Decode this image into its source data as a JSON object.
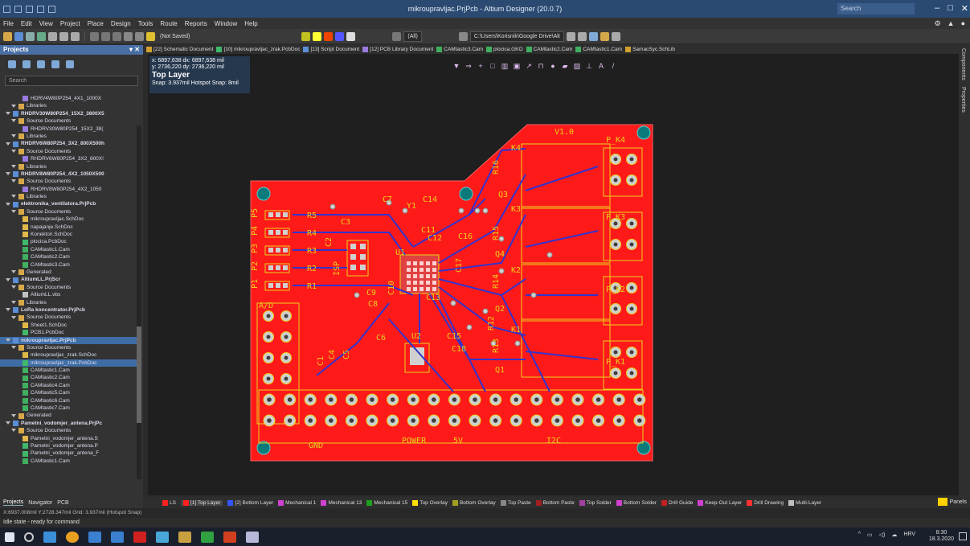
{
  "window": {
    "title": "mikroupravljac.PrjPcb - Altium Designer (20.0.7)",
    "search_placeholder": "Search"
  },
  "menu": [
    "File",
    "Edit",
    "View",
    "Project",
    "Place",
    "Design",
    "Tools",
    "Route",
    "Reports",
    "Window",
    "Help"
  ],
  "toolbar": {
    "saved_state": "(Not Saved)",
    "filter": "(All)",
    "path": "C:\\Users\\Korisnik\\Google Drive\\Alt"
  },
  "projects_panel": {
    "title": "Projects",
    "search_placeholder": "Search",
    "tree": [
      {
        "label": "HDRV4W80P254_4X1_1000X",
        "icon": "lib",
        "indent": 4
      },
      {
        "label": "Libraries",
        "icon": "folder",
        "indent": 2
      },
      {
        "label": "RHDRV30W80P254_15X2_3800X5",
        "icon": "proj",
        "indent": 1,
        "bold": true
      },
      {
        "label": "Source Documents",
        "icon": "folder",
        "indent": 2
      },
      {
        "label": "RHDRV30W80P254_15X2_38(",
        "icon": "lib",
        "indent": 4
      },
      {
        "label": "Libraries",
        "icon": "folder",
        "indent": 2
      },
      {
        "label": "RHDRV6W80P254_3X2_800X500h",
        "icon": "proj",
        "indent": 1,
        "bold": true
      },
      {
        "label": "Source Documents",
        "icon": "folder",
        "indent": 2
      },
      {
        "label": "RHDRV6W80P254_3X2_800X!",
        "icon": "lib",
        "indent": 4
      },
      {
        "label": "Libraries",
        "icon": "folder",
        "indent": 2
      },
      {
        "label": "RHDRV8W80P254_4X2_1050X500",
        "icon": "proj",
        "indent": 1,
        "bold": true
      },
      {
        "label": "Source Documents",
        "icon": "folder",
        "indent": 2
      },
      {
        "label": "RHDRV8W80P254_4X2_1050",
        "icon": "lib",
        "indent": 4
      },
      {
        "label": "Libraries",
        "icon": "folder",
        "indent": 2
      },
      {
        "label": "elektronika_ventilatora.PrjPcb",
        "icon": "proj",
        "indent": 1,
        "bold": true
      },
      {
        "label": "Source Documents",
        "icon": "folder",
        "indent": 2
      },
      {
        "label": "mikroupravljac.SchDoc",
        "icon": "sch",
        "indent": 4
      },
      {
        "label": "napajanje.SchDoc",
        "icon": "sch",
        "indent": 4
      },
      {
        "label": "Konektori.SchDoc",
        "icon": "sch",
        "indent": 4
      },
      {
        "label": "plocica.PcbDoc",
        "icon": "pcb",
        "indent": 4
      },
      {
        "label": "CAMtastic1.Cam",
        "icon": "cam",
        "indent": 4
      },
      {
        "label": "CAMtastic2.Cam",
        "icon": "cam",
        "indent": 4
      },
      {
        "label": "CAMtastic3.Cam",
        "icon": "cam",
        "indent": 4
      },
      {
        "label": "Generated",
        "icon": "folder",
        "indent": 2
      },
      {
        "label": "AltiumLL.PrjScr",
        "icon": "proj",
        "indent": 1,
        "bold": true
      },
      {
        "label": "Source Documents",
        "icon": "folder",
        "indent": 2
      },
      {
        "label": "AltiumLL.vbs",
        "icon": "doc",
        "indent": 4
      },
      {
        "label": "Libraries",
        "icon": "folder",
        "indent": 2
      },
      {
        "label": "LoRa koncentrator.PrjPcb",
        "icon": "proj",
        "indent": 1,
        "bold": true
      },
      {
        "label": "Source Documents",
        "icon": "folder",
        "indent": 2
      },
      {
        "label": "Sheet1.SchDoc",
        "icon": "sch",
        "indent": 4
      },
      {
        "label": "PCB1.PcbDoc",
        "icon": "pcb",
        "indent": 4
      },
      {
        "label": "mikroupravljac.PrjPcb",
        "icon": "proj",
        "indent": 1,
        "bold": true,
        "selected": true
      },
      {
        "label": "Source Documents",
        "icon": "folder",
        "indent": 2
      },
      {
        "label": "mikroupravljac_zrak.SchDoc",
        "icon": "sch",
        "indent": 4
      },
      {
        "label": "mikroupravljac_zrak.PcbDoc",
        "icon": "pcb",
        "indent": 4,
        "selected": true
      },
      {
        "label": "CAMtastic1.Cam",
        "icon": "cam",
        "indent": 4
      },
      {
        "label": "CAMtastic2.Cam",
        "icon": "cam",
        "indent": 4
      },
      {
        "label": "CAMtastic4.Cam",
        "icon": "cam",
        "indent": 4
      },
      {
        "label": "CAMtastic5.Cam",
        "icon": "cam",
        "indent": 4
      },
      {
        "label": "CAMtastic6.Cam",
        "icon": "cam",
        "indent": 4
      },
      {
        "label": "CAMtastic7.Cam",
        "icon": "cam",
        "indent": 4
      },
      {
        "label": "Generated",
        "icon": "folder",
        "indent": 2
      },
      {
        "label": "Pametni_vodomjer_antena.PrjPc",
        "icon": "proj",
        "indent": 1,
        "bold": true
      },
      {
        "label": "Source Documents",
        "icon": "folder",
        "indent": 2
      },
      {
        "label": "Pametni_vodomjer_antena.S",
        "icon": "sch",
        "indent": 4
      },
      {
        "label": "Pametni_vodomjer_antena.P",
        "icon": "pcb",
        "indent": 4
      },
      {
        "label": "Pametni_vodomjer_antena_F",
        "icon": "pcb",
        "indent": 4
      },
      {
        "label": "CAMtastic1.Cam",
        "icon": "cam",
        "indent": 4
      }
    ],
    "bottom_tabs": [
      "Projects",
      "Navigator",
      "PCB"
    ]
  },
  "doc_tabs": [
    {
      "label": "[22] Schematic Document",
      "color": "#d0a030"
    },
    {
      "label": "[10] mikroupravljac_zrak.PcbDoc",
      "color": "#3fb86a"
    },
    {
      "label": "[13] Script Document",
      "color": "#5b8ed6"
    },
    {
      "label": "[12] PCB Library Document",
      "color": "#9a7adf"
    },
    {
      "label": "CAMtastic3.Cam",
      "color": "#40b060"
    },
    {
      "label": "plocica.GKO",
      "color": "#40b060"
    },
    {
      "label": "CAMtastic2.Cam",
      "color": "#40b060"
    },
    {
      "label": "CAMtastic1.Cam",
      "color": "#40b060"
    },
    {
      "label": "SamacSyc.SchLib",
      "color": "#d0a030"
    }
  ],
  "coord_readout": {
    "line1": "x: 6897,638   dx: 6897,638 mil",
    "line2": "y: 2736,220   dy: 2736,220 mil",
    "layer": "Top Layer",
    "snap": "Snap: 3.937mil Hotspot Snap: 8mil"
  },
  "pcb": {
    "board_color": "#ff1a1a",
    "silk_color": "#e8d21a",
    "trace_color": "#3333cc",
    "labels": [
      "V1.0",
      "K4",
      "P_K4",
      "R16",
      "Q3",
      "K3",
      "P_K3",
      "R15",
      "Q4",
      "K2",
      "P_K2",
      "R14",
      "Q2",
      "K1",
      "R13",
      "Q1",
      "P_K1",
      "C7",
      "Y1",
      "C14",
      "R5",
      "C3",
      "P5",
      "P4",
      "P3",
      "P2",
      "P1",
      "R4",
      "R3",
      "R2",
      "R1",
      "C2",
      "ISP",
      "U1",
      "C12",
      "C16",
      "C11",
      "C9",
      "C8",
      "C10",
      "C13",
      "C17",
      "C6",
      "U2",
      "C15",
      "C18",
      "R12",
      "C4",
      "C5",
      "C1",
      "GND",
      "POWER",
      "5V",
      "I2C",
      "A/D"
    ]
  },
  "layers": [
    {
      "label": "LS",
      "color": "#ff2020"
    },
    {
      "label": "[1] Top Layer",
      "color": "#ff2020",
      "active": true
    },
    {
      "label": "[2] Bottom Layer",
      "color": "#3355ff"
    },
    {
      "label": "Mechanical 1",
      "color": "#d040d0"
    },
    {
      "label": "Mechanical 13",
      "color": "#d040d0"
    },
    {
      "label": "Mechanical 15",
      "color": "#20a020"
    },
    {
      "label": "Top Overlay",
      "color": "#ffe000"
    },
    {
      "label": "Bottom Overlay",
      "color": "#a0a020"
    },
    {
      "label": "Top Paste",
      "color": "#888888"
    },
    {
      "label": "Bottom Paste",
      "color": "#a02020"
    },
    {
      "label": "Top Solder",
      "color": "#a040a0"
    },
    {
      "label": "Bottom Solder",
      "color": "#d040d0"
    },
    {
      "label": "Drill Guide",
      "color": "#c02020"
    },
    {
      "label": "Keep-Out Layer",
      "color": "#d040d0"
    },
    {
      "label": "Drill Drawing",
      "color": "#ff3030"
    },
    {
      "label": "Multi-Layer",
      "color": "#c0c0c0"
    }
  ],
  "panels_button": "Panels",
  "status": {
    "line1": "X:6937.008mil Y:2728.347mil   Grid: 3.937mil   (Hotspot Snap)",
    "line2": "Idle state - ready for command"
  },
  "taskbar": {
    "lang": "HRV",
    "time": "8:30",
    "date": "18.3.2020"
  },
  "right_panels": [
    "Components",
    "Properties"
  ]
}
